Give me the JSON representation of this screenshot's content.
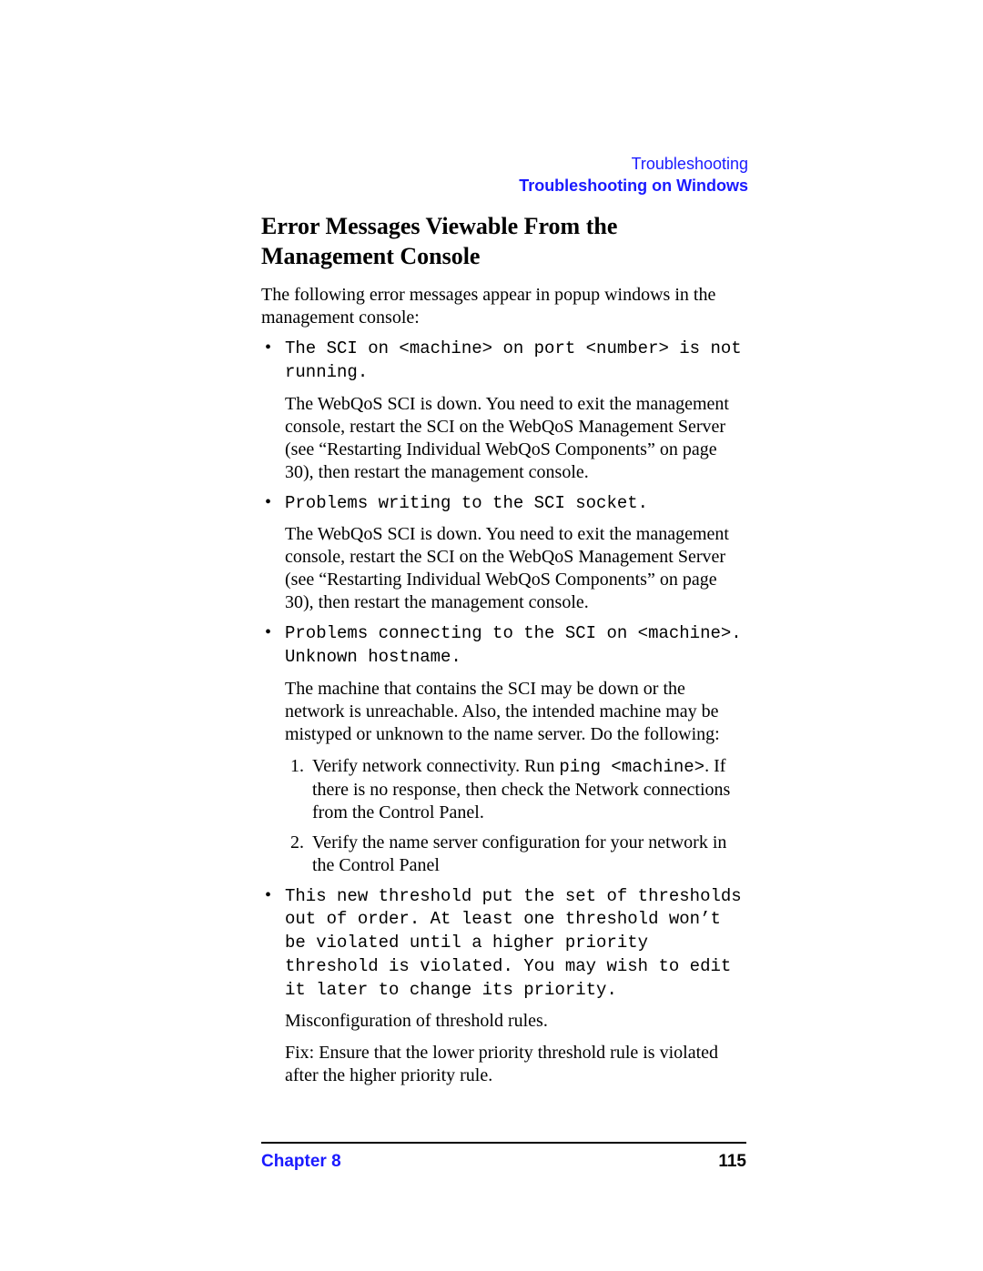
{
  "header": {
    "line1": "Troubleshooting",
    "line2": "Troubleshooting on Windows"
  },
  "section_title": "Error Messages Viewable From the Management Console",
  "intro": "The following error messages appear in popup windows in the management console:",
  "bullets": [
    {
      "err": "The SCI on <machine> on port <number> is not running.",
      "desc": "The WebQoS SCI is down. You need to exit the management console, restart the SCI on the WebQoS Management Server (see “Restarting Individual WebQoS Components” on page 30), then restart the management console."
    },
    {
      "err": "Problems writing to the SCI socket.",
      "desc": "The WebQoS SCI is down. You need to exit the management console, restart the SCI on the WebQoS Management Server (see “Restarting Individual WebQoS Components” on page 30), then restart the management console."
    },
    {
      "err": "Problems connecting to the SCI on <machine>. Unknown hostname.",
      "desc": "The machine that contains the SCI may be down or the network is unreachable. Also, the intended machine may be mistyped or unknown to the name server. Do the following:",
      "steps": {
        "s1_pre": "Verify network connectivity. Run ",
        "s1_code": "ping <machine>",
        "s1_post": ". If there is no response, then check the Network connections from the Control Panel.",
        "s2": "Verify the name server configuration for your network in the Control Panel"
      }
    },
    {
      "err": "This new threshold put the set of thresholds out of order. At least one threshold won’t be violated until a higher priority threshold is violated. You may wish to edit it later to change its priority.",
      "desc": "Misconfiguration of threshold rules.",
      "desc2": "Fix: Ensure that the lower priority threshold rule is violated after the higher priority rule."
    }
  ],
  "footer": {
    "chapter": "Chapter 8",
    "page": "115"
  }
}
